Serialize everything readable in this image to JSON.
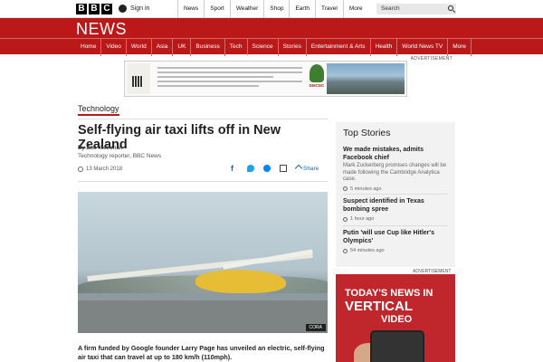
{
  "masthead": {
    "logo_letters": [
      "B",
      "B",
      "C"
    ],
    "signin_label": "Sign in",
    "nav": [
      "News",
      "Sport",
      "Weather",
      "Shop",
      "Earth",
      "Travel",
      "More"
    ],
    "search_placeholder": "Search"
  },
  "news_header": {
    "title": "NEWS",
    "sections": [
      "Home",
      "Video",
      "World",
      "Asia",
      "UK",
      "Business",
      "Tech",
      "Science",
      "Stories",
      "Entertainment & Arts",
      "Health",
      "World News TV",
      "More"
    ],
    "active_section": "Tech"
  },
  "ad_top": {
    "label": "ADVERTISEMENT",
    "brand": "DMCDC"
  },
  "article": {
    "tag": "Technology",
    "headline": "Self-flying air taxi lifts off in New Zealand",
    "author": "By Zoe Kleinman",
    "author_role": "Technology reporter, BBC News",
    "date": "13 March 2018",
    "share_label": "Share",
    "image_credit": "CORA",
    "lede": "A firm funded by Google founder Larry Page has unveiled an electric, self-flying air taxi that can travel at up to 180 km/h (110mph)."
  },
  "sidebar": {
    "top_stories_title": "Top Stories",
    "stories": [
      {
        "headline": "We made mistakes, admits Facebook chief",
        "summary": "Mark Zuckerberg promises changes will be made following the Cambridge Analytica case.",
        "time": "5 minutes ago"
      },
      {
        "headline": "Suspect identified in Texas bombing spree",
        "summary": "",
        "time": "1 hour ago"
      },
      {
        "headline": "Putin 'will use Cup like Hitler's Olympics'",
        "summary": "",
        "time": "54 minutes ago"
      }
    ],
    "ad_label": "ADVERTISEMENT",
    "ad_line1": "TODAY'S NEWS IN",
    "ad_line2": "VERTICAL",
    "ad_line3": "VIDEO"
  },
  "colors": {
    "bbc_red": "#bb1919",
    "ad_red": "#c0272d",
    "link_blue": "#1a6fb5"
  }
}
